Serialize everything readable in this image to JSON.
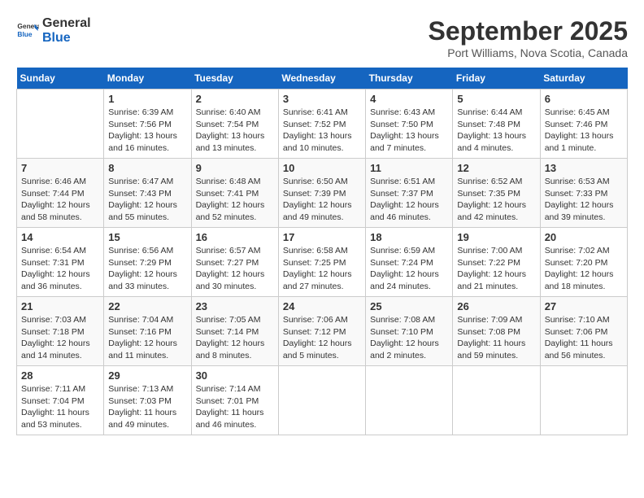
{
  "header": {
    "logo_line1": "General",
    "logo_line2": "Blue",
    "month": "September 2025",
    "location": "Port Williams, Nova Scotia, Canada"
  },
  "days_of_week": [
    "Sunday",
    "Monday",
    "Tuesday",
    "Wednesday",
    "Thursday",
    "Friday",
    "Saturday"
  ],
  "weeks": [
    [
      {
        "day": "",
        "info": ""
      },
      {
        "day": "1",
        "info": "Sunrise: 6:39 AM\nSunset: 7:56 PM\nDaylight: 13 hours\nand 16 minutes."
      },
      {
        "day": "2",
        "info": "Sunrise: 6:40 AM\nSunset: 7:54 PM\nDaylight: 13 hours\nand 13 minutes."
      },
      {
        "day": "3",
        "info": "Sunrise: 6:41 AM\nSunset: 7:52 PM\nDaylight: 13 hours\nand 10 minutes."
      },
      {
        "day": "4",
        "info": "Sunrise: 6:43 AM\nSunset: 7:50 PM\nDaylight: 13 hours\nand 7 minutes."
      },
      {
        "day": "5",
        "info": "Sunrise: 6:44 AM\nSunset: 7:48 PM\nDaylight: 13 hours\nand 4 minutes."
      },
      {
        "day": "6",
        "info": "Sunrise: 6:45 AM\nSunset: 7:46 PM\nDaylight: 13 hours\nand 1 minute."
      }
    ],
    [
      {
        "day": "7",
        "info": "Sunrise: 6:46 AM\nSunset: 7:44 PM\nDaylight: 12 hours\nand 58 minutes."
      },
      {
        "day": "8",
        "info": "Sunrise: 6:47 AM\nSunset: 7:43 PM\nDaylight: 12 hours\nand 55 minutes."
      },
      {
        "day": "9",
        "info": "Sunrise: 6:48 AM\nSunset: 7:41 PM\nDaylight: 12 hours\nand 52 minutes."
      },
      {
        "day": "10",
        "info": "Sunrise: 6:50 AM\nSunset: 7:39 PM\nDaylight: 12 hours\nand 49 minutes."
      },
      {
        "day": "11",
        "info": "Sunrise: 6:51 AM\nSunset: 7:37 PM\nDaylight: 12 hours\nand 46 minutes."
      },
      {
        "day": "12",
        "info": "Sunrise: 6:52 AM\nSunset: 7:35 PM\nDaylight: 12 hours\nand 42 minutes."
      },
      {
        "day": "13",
        "info": "Sunrise: 6:53 AM\nSunset: 7:33 PM\nDaylight: 12 hours\nand 39 minutes."
      }
    ],
    [
      {
        "day": "14",
        "info": "Sunrise: 6:54 AM\nSunset: 7:31 PM\nDaylight: 12 hours\nand 36 minutes."
      },
      {
        "day": "15",
        "info": "Sunrise: 6:56 AM\nSunset: 7:29 PM\nDaylight: 12 hours\nand 33 minutes."
      },
      {
        "day": "16",
        "info": "Sunrise: 6:57 AM\nSunset: 7:27 PM\nDaylight: 12 hours\nand 30 minutes."
      },
      {
        "day": "17",
        "info": "Sunrise: 6:58 AM\nSunset: 7:25 PM\nDaylight: 12 hours\nand 27 minutes."
      },
      {
        "day": "18",
        "info": "Sunrise: 6:59 AM\nSunset: 7:24 PM\nDaylight: 12 hours\nand 24 minutes."
      },
      {
        "day": "19",
        "info": "Sunrise: 7:00 AM\nSunset: 7:22 PM\nDaylight: 12 hours\nand 21 minutes."
      },
      {
        "day": "20",
        "info": "Sunrise: 7:02 AM\nSunset: 7:20 PM\nDaylight: 12 hours\nand 18 minutes."
      }
    ],
    [
      {
        "day": "21",
        "info": "Sunrise: 7:03 AM\nSunset: 7:18 PM\nDaylight: 12 hours\nand 14 minutes."
      },
      {
        "day": "22",
        "info": "Sunrise: 7:04 AM\nSunset: 7:16 PM\nDaylight: 12 hours\nand 11 minutes."
      },
      {
        "day": "23",
        "info": "Sunrise: 7:05 AM\nSunset: 7:14 PM\nDaylight: 12 hours\nand 8 minutes."
      },
      {
        "day": "24",
        "info": "Sunrise: 7:06 AM\nSunset: 7:12 PM\nDaylight: 12 hours\nand 5 minutes."
      },
      {
        "day": "25",
        "info": "Sunrise: 7:08 AM\nSunset: 7:10 PM\nDaylight: 12 hours\nand 2 minutes."
      },
      {
        "day": "26",
        "info": "Sunrise: 7:09 AM\nSunset: 7:08 PM\nDaylight: 11 hours\nand 59 minutes."
      },
      {
        "day": "27",
        "info": "Sunrise: 7:10 AM\nSunset: 7:06 PM\nDaylight: 11 hours\nand 56 minutes."
      }
    ],
    [
      {
        "day": "28",
        "info": "Sunrise: 7:11 AM\nSunset: 7:04 PM\nDaylight: 11 hours\nand 53 minutes."
      },
      {
        "day": "29",
        "info": "Sunrise: 7:13 AM\nSunset: 7:03 PM\nDaylight: 11 hours\nand 49 minutes."
      },
      {
        "day": "30",
        "info": "Sunrise: 7:14 AM\nSunset: 7:01 PM\nDaylight: 11 hours\nand 46 minutes."
      },
      {
        "day": "",
        "info": ""
      },
      {
        "day": "",
        "info": ""
      },
      {
        "day": "",
        "info": ""
      },
      {
        "day": "",
        "info": ""
      }
    ]
  ]
}
